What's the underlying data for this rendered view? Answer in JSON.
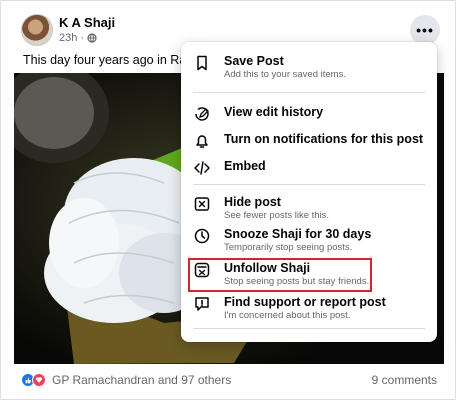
{
  "post": {
    "author": "K A Shaji",
    "time": "23h",
    "privacy_icon": "globe-icon",
    "more_label": "•••",
    "text": "This day four years ago in Ramanathapuram"
  },
  "footer": {
    "reactions": [
      "like-icon",
      "love-icon"
    ],
    "reactors": "GP Ramachandran and 97 others",
    "comments": "9 comments"
  },
  "menu": {
    "items": [
      {
        "title": "Save Post",
        "subtitle": "Add this to your saved items.",
        "icon": "bookmark-icon"
      },
      {
        "title": "View edit history",
        "subtitle": "",
        "icon": "pencil-history-icon"
      },
      {
        "title": "Turn on notifications for this post",
        "subtitle": "",
        "icon": "bell-icon"
      },
      {
        "title": "Embed",
        "subtitle": "",
        "icon": "code-icon"
      },
      {
        "title": "Hide post",
        "subtitle": "See fewer posts like this.",
        "icon": "hide-icon"
      },
      {
        "title": "Snooze Shaji for 30 days",
        "subtitle": "Temporarily stop seeing posts.",
        "icon": "clock-icon"
      },
      {
        "title": "Unfollow Shaji",
        "subtitle": "Stop seeing posts but stay friends.",
        "icon": "unfollow-icon"
      },
      {
        "title": "Find support or report post",
        "subtitle": "I'm concerned about this post.",
        "icon": "report-icon"
      }
    ]
  },
  "colors": {
    "highlight": "#d8232a",
    "like": "#1877f2",
    "love": "#f33e58"
  }
}
